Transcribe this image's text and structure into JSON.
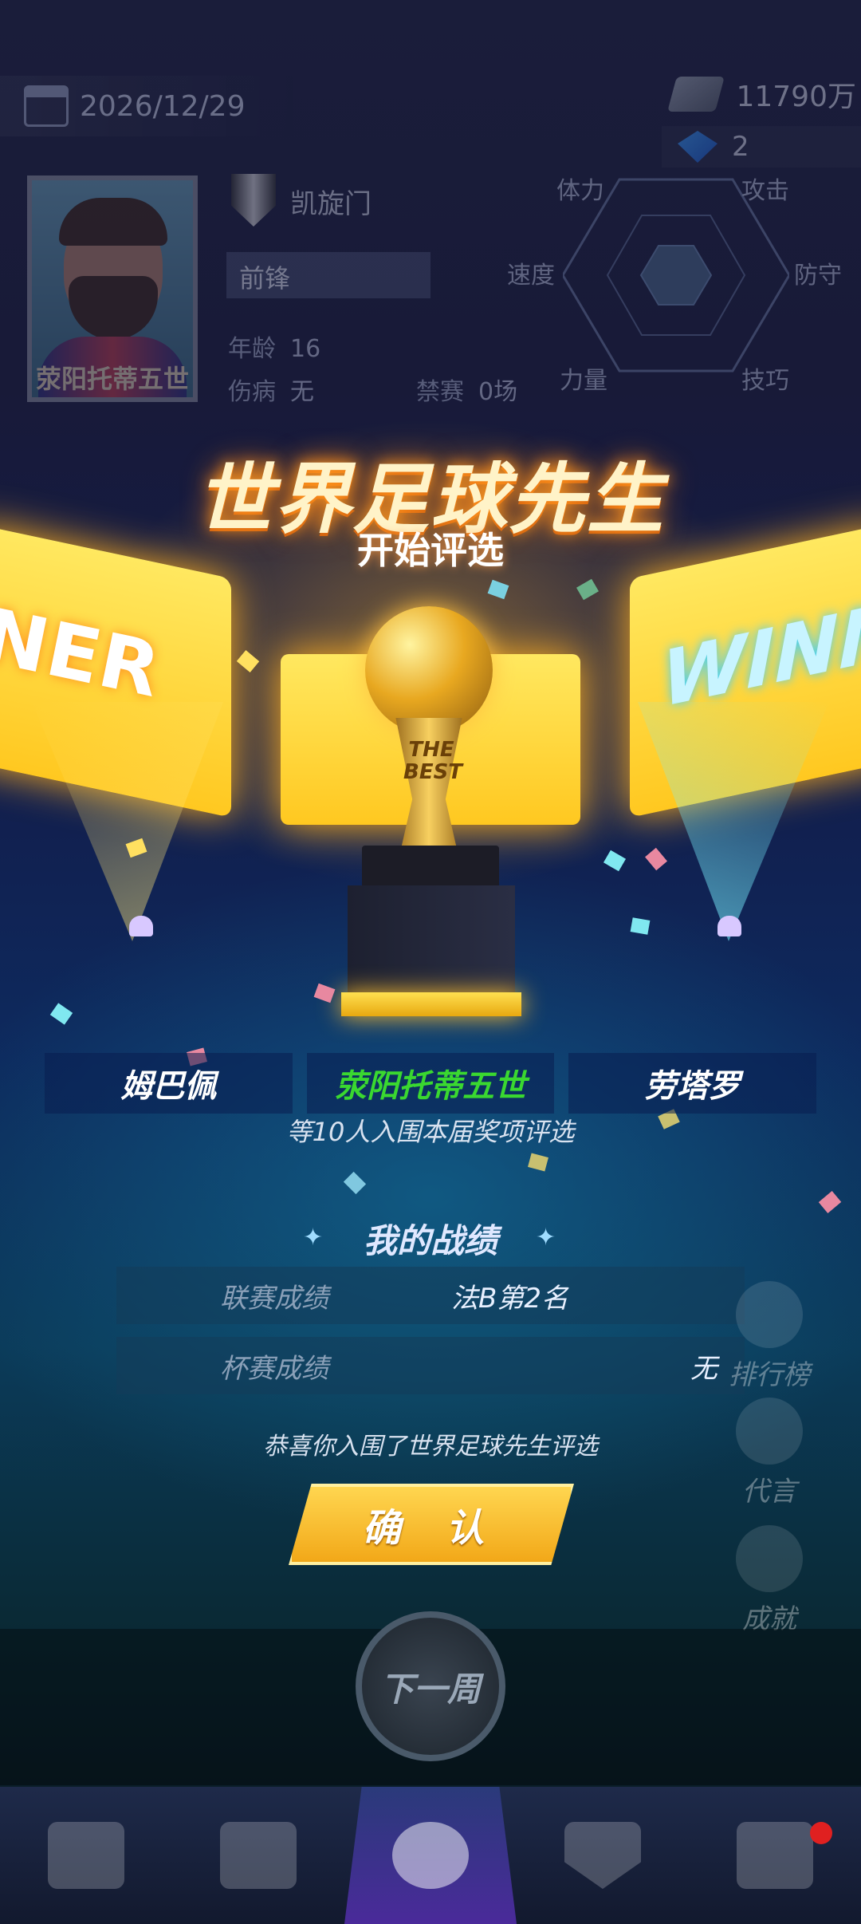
{
  "status": {
    "date": "2026/12/29",
    "money": "11790万",
    "gems": "2"
  },
  "player": {
    "name": "荥阳托蒂五世",
    "club": "凯旋门",
    "position": "前锋",
    "age_label": "年龄",
    "age": "16",
    "injury_label": "伤病",
    "injury": "无",
    "ban_label": "禁赛",
    "ban": "0场"
  },
  "attributes": {
    "stamina": "体力",
    "attack": "攻击",
    "speed": "速度",
    "defense": "防守",
    "power": "力量",
    "skill": "技巧"
  },
  "award": {
    "title": "世界足球先生",
    "subtitle": "开始评选",
    "screen_left": "NER",
    "screen_right": "WINN",
    "trophy_text_1": "THE",
    "trophy_text_2": "BEST",
    "candidates": [
      "姆巴佩",
      "荥阳托蒂五世",
      "劳塔罗"
    ],
    "shortlist_note": "等10人入围本届奖项评选"
  },
  "record": {
    "title": "我的战绩",
    "league_label": "联赛成绩",
    "league_value": "法B第2名",
    "cup_label": "杯赛成绩",
    "cup_value": "无"
  },
  "congrats": "恭喜你入围了世界足球先生评选",
  "confirm_label": "确 认",
  "next_week_label": "下一周",
  "side_menu": [
    "排行榜",
    "代言",
    "成就"
  ],
  "colors": {
    "accent_gold": "#ffc820",
    "highlight_green": "#3ad830",
    "notification_red": "#e02020"
  }
}
